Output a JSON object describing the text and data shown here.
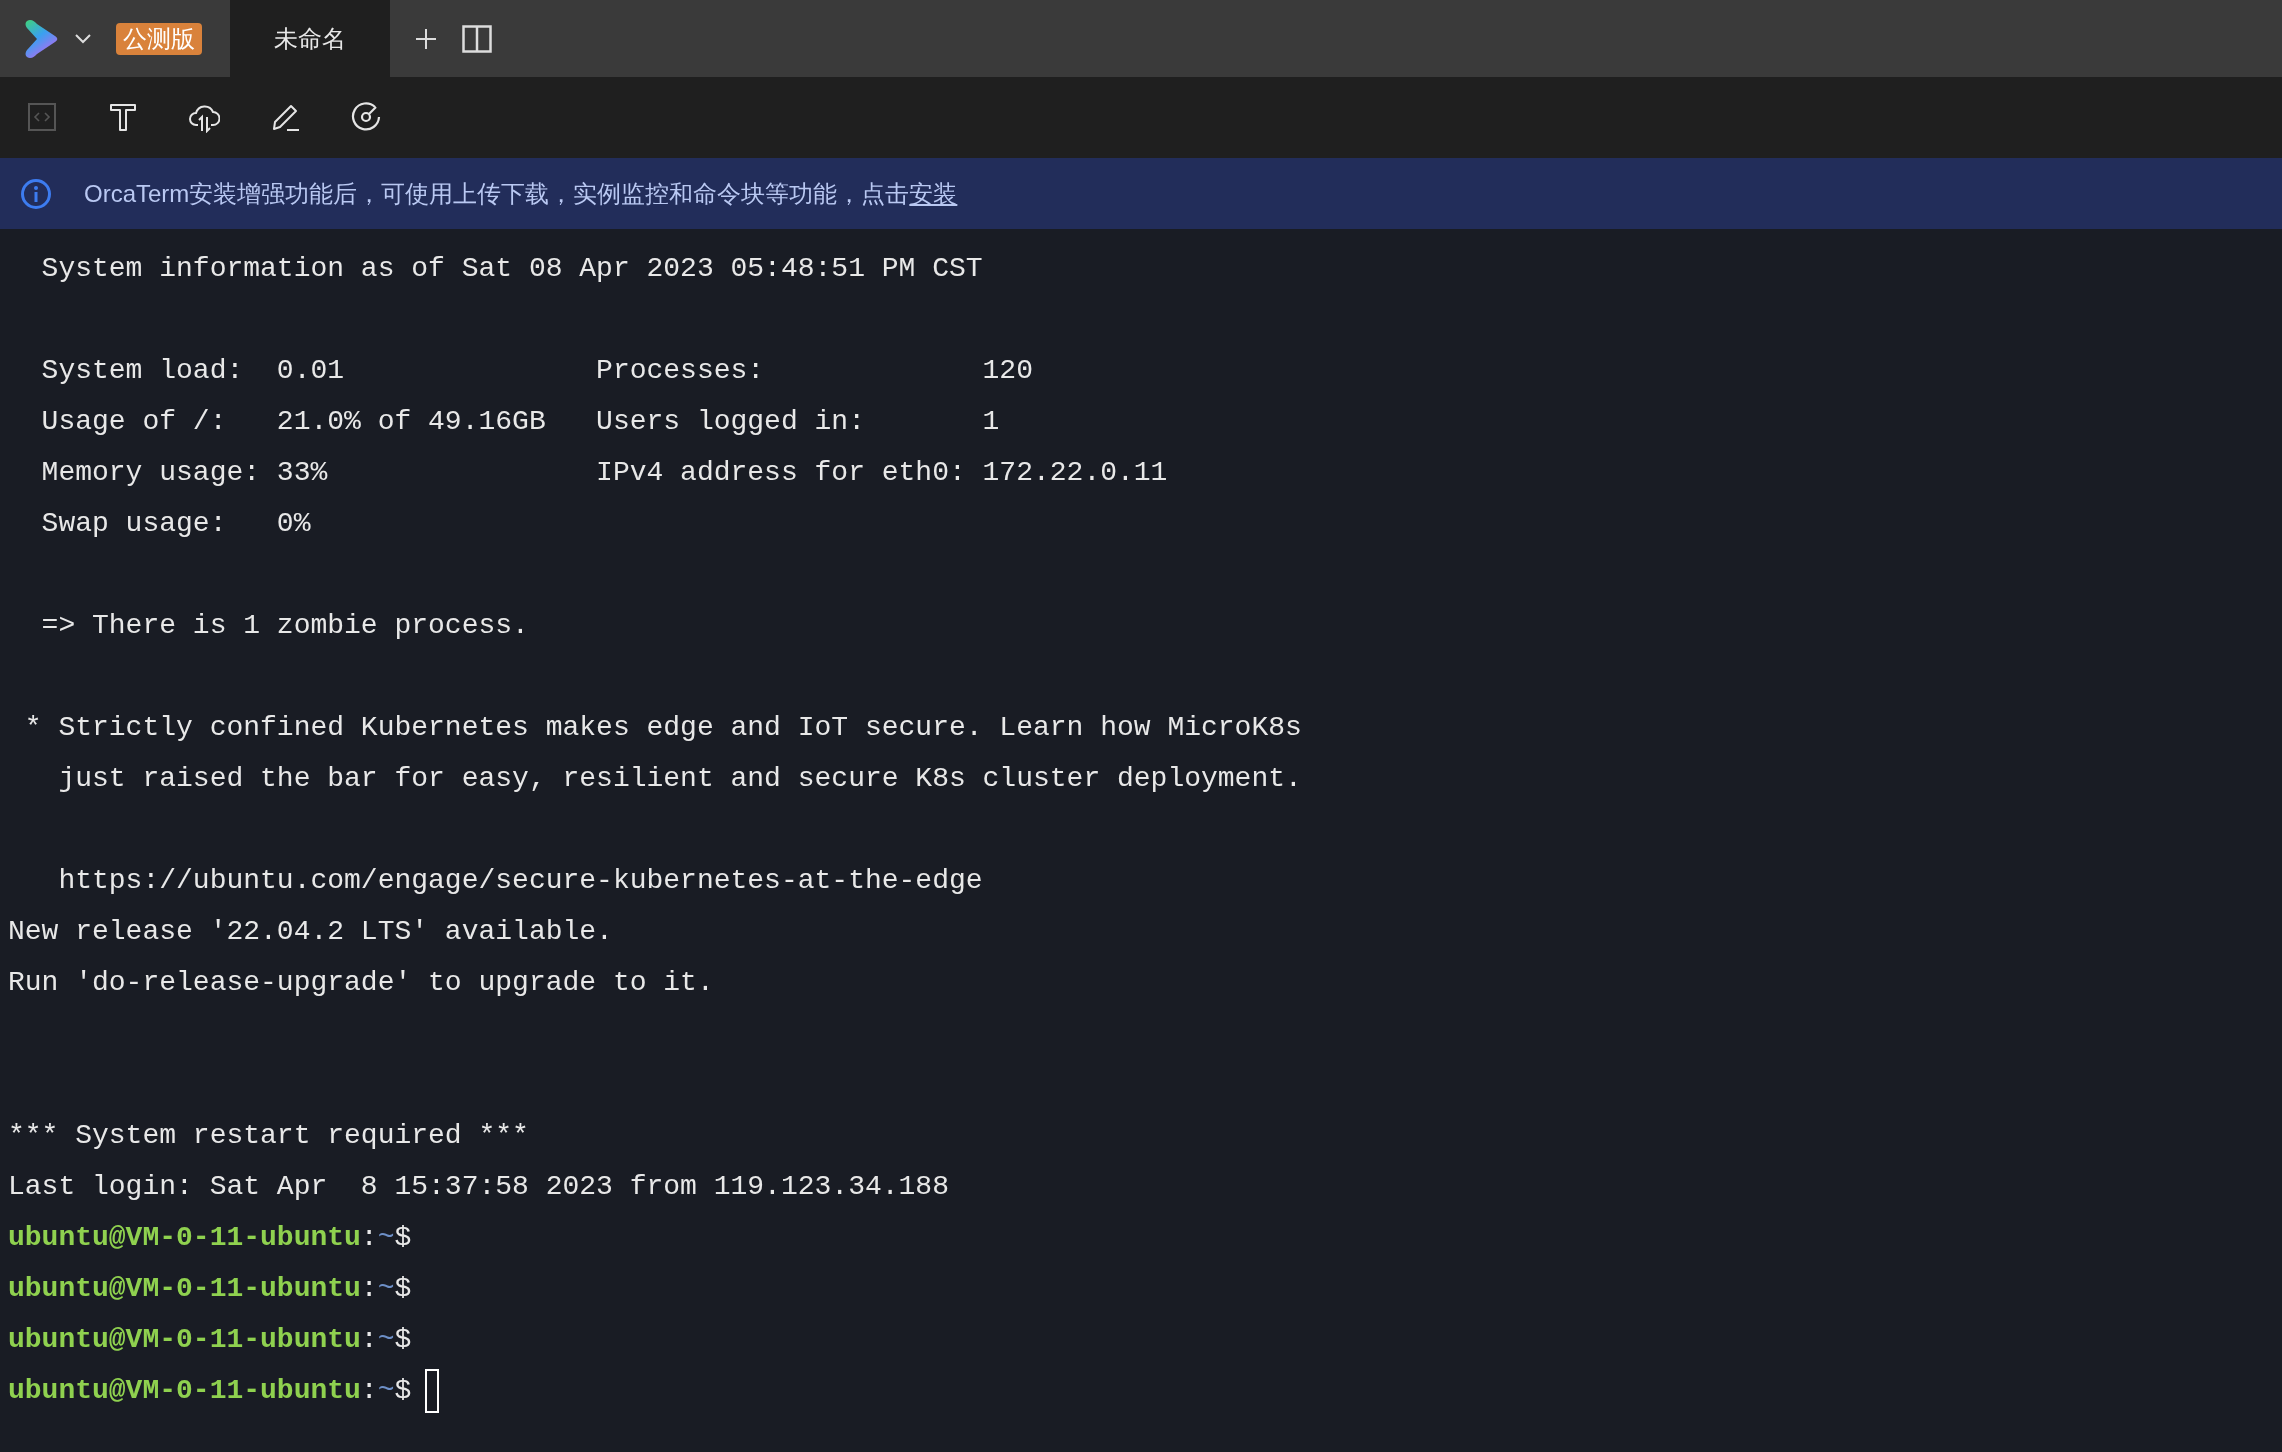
{
  "titlebar": {
    "badge": "公测版",
    "tabs": [
      {
        "label": "未命名",
        "selected": true
      }
    ]
  },
  "toolbar": [
    {
      "kind": "code",
      "disabled": true
    },
    {
      "kind": "text",
      "disabled": false
    },
    {
      "kind": "cloud",
      "disabled": false
    },
    {
      "kind": "pencil",
      "disabled": false
    },
    {
      "kind": "disc",
      "disabled": false
    }
  ],
  "banner": {
    "text": "OrcaTerm安装增强功能后，可使用上传下载，实例监控和命令块等功能，点击",
    "link": "安装"
  },
  "terminal": {
    "lines": [
      {
        "kind": "output",
        "text": "  System information as of Sat 08 Apr 2023 05:48:51 PM CST"
      },
      {
        "kind": "blank"
      },
      {
        "kind": "output",
        "text": "  System load:  0.01               Processes:             120"
      },
      {
        "kind": "output",
        "text": "  Usage of /:   21.0% of 49.16GB   Users logged in:       1"
      },
      {
        "kind": "output",
        "text": "  Memory usage: 33%                IPv4 address for eth0: 172.22.0.11"
      },
      {
        "kind": "output",
        "text": "  Swap usage:   0%"
      },
      {
        "kind": "blank"
      },
      {
        "kind": "output",
        "text": "  => There is 1 zombie process."
      },
      {
        "kind": "blank"
      },
      {
        "kind": "output",
        "text": " * Strictly confined Kubernetes makes edge and IoT secure. Learn how MicroK8s"
      },
      {
        "kind": "output",
        "text": "   just raised the bar for easy, resilient and secure K8s cluster deployment."
      },
      {
        "kind": "blank"
      },
      {
        "kind": "output",
        "text": "   https://ubuntu.com/engage/secure-kubernetes-at-the-edge"
      },
      {
        "kind": "output",
        "text": "New release '22.04.2 LTS' available."
      },
      {
        "kind": "output",
        "text": "Run 'do-release-upgrade' to upgrade to it."
      },
      {
        "kind": "blank"
      },
      {
        "kind": "blank"
      },
      {
        "kind": "output",
        "text": "*** System restart required ***"
      },
      {
        "kind": "output",
        "text": "Last login: Sat Apr  8 15:37:58 2023 from 119.123.34.188"
      },
      {
        "kind": "prompt",
        "user_host": "ubuntu@VM-0-11-ubuntu",
        "separator": ":",
        "path": "~",
        "symbol": "$",
        "cursor": false
      },
      {
        "kind": "prompt",
        "user_host": "ubuntu@VM-0-11-ubuntu",
        "separator": ":",
        "path": "~",
        "symbol": "$",
        "cursor": false
      },
      {
        "kind": "prompt",
        "user_host": "ubuntu@VM-0-11-ubuntu",
        "separator": ":",
        "path": "~",
        "symbol": "$",
        "cursor": false
      },
      {
        "kind": "prompt",
        "user_host": "ubuntu@VM-0-11-ubuntu",
        "separator": ":",
        "path": "~",
        "symbol": "$",
        "cursor": true
      }
    ]
  }
}
